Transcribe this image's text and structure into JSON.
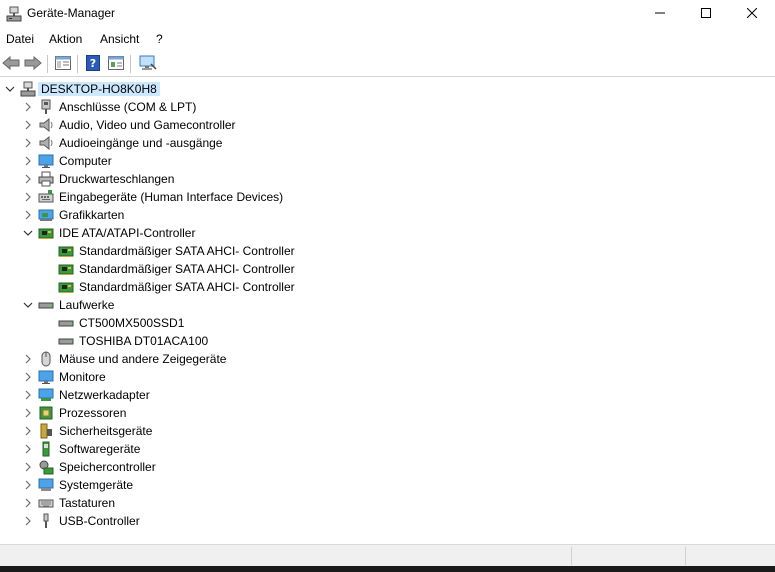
{
  "window": {
    "title": "Geräte-Manager",
    "minimize_icon": "minimize-icon",
    "maximize_icon": "maximize-icon",
    "close_icon": "close-icon"
  },
  "menu": [
    "Datei",
    "Aktion",
    "Ansicht",
    "?"
  ],
  "toolbar": [
    {
      "name": "back-icon"
    },
    {
      "name": "forward-icon"
    },
    {
      "name": "properties-view-icon"
    },
    {
      "name": "help-icon"
    },
    {
      "name": "details-view-icon"
    },
    {
      "name": "monitor-scan-icon"
    }
  ],
  "tree": {
    "root": {
      "label": "DESKTOP-HO8K0H8",
      "icon": "computer-icon",
      "expanded": true
    },
    "items": [
      {
        "label": "Anschlüsse (COM & LPT)",
        "icon": "port-icon",
        "expanded": false
      },
      {
        "label": "Audio, Video und Gamecontroller",
        "icon": "speaker-icon",
        "expanded": false
      },
      {
        "label": "Audioeingänge und -ausgänge",
        "icon": "speaker-icon",
        "expanded": false
      },
      {
        "label": "Computer",
        "icon": "monitor-icon",
        "expanded": false
      },
      {
        "label": "Druckwarteschlangen",
        "icon": "printer-icon",
        "expanded": false
      },
      {
        "label": "Eingabegeräte (Human Interface Devices)",
        "icon": "hid-icon",
        "expanded": false
      },
      {
        "label": "Grafikkarten",
        "icon": "graphics-card-icon",
        "expanded": false
      },
      {
        "label": "IDE ATA/ATAPI-Controller",
        "icon": "ide-controller-icon",
        "expanded": true,
        "children": [
          {
            "label": "Standardmäßiger SATA AHCI- Controller",
            "icon": "ide-controller-icon"
          },
          {
            "label": "Standardmäßiger SATA AHCI- Controller",
            "icon": "ide-controller-icon"
          },
          {
            "label": "Standardmäßiger SATA AHCI- Controller",
            "icon": "ide-controller-icon"
          }
        ]
      },
      {
        "label": "Laufwerke",
        "icon": "disk-drive-icon",
        "expanded": true,
        "children": [
          {
            "label": "CT500MX500SSD1",
            "icon": "disk-drive-icon"
          },
          {
            "label": "TOSHIBA DT01ACA100",
            "icon": "disk-drive-icon"
          }
        ]
      },
      {
        "label": "Mäuse und andere Zeigegeräte",
        "icon": "mouse-icon",
        "expanded": false
      },
      {
        "label": "Monitore",
        "icon": "monitor-icon",
        "expanded": false
      },
      {
        "label": "Netzwerkadapter",
        "icon": "network-icon",
        "expanded": false
      },
      {
        "label": "Prozessoren",
        "icon": "processor-icon",
        "expanded": false
      },
      {
        "label": "Sicherheitsgeräte",
        "icon": "security-device-icon",
        "expanded": false
      },
      {
        "label": "Softwaregeräte",
        "icon": "software-device-icon",
        "expanded": false
      },
      {
        "label": "Speichercontroller",
        "icon": "storage-controller-icon",
        "expanded": false
      },
      {
        "label": "Systemgeräte",
        "icon": "system-device-icon",
        "expanded": false
      },
      {
        "label": "Tastaturen",
        "icon": "keyboard-icon",
        "expanded": false
      },
      {
        "label": "USB-Controller",
        "icon": "usb-icon",
        "expanded": false
      }
    ]
  },
  "colors": {
    "selection": "#cce8ff",
    "chevron": "#6e6e6e",
    "icon_blue": "#2f7fd6",
    "icon_green": "#3a9a3a",
    "icon_gray": "#8a8a8a"
  }
}
